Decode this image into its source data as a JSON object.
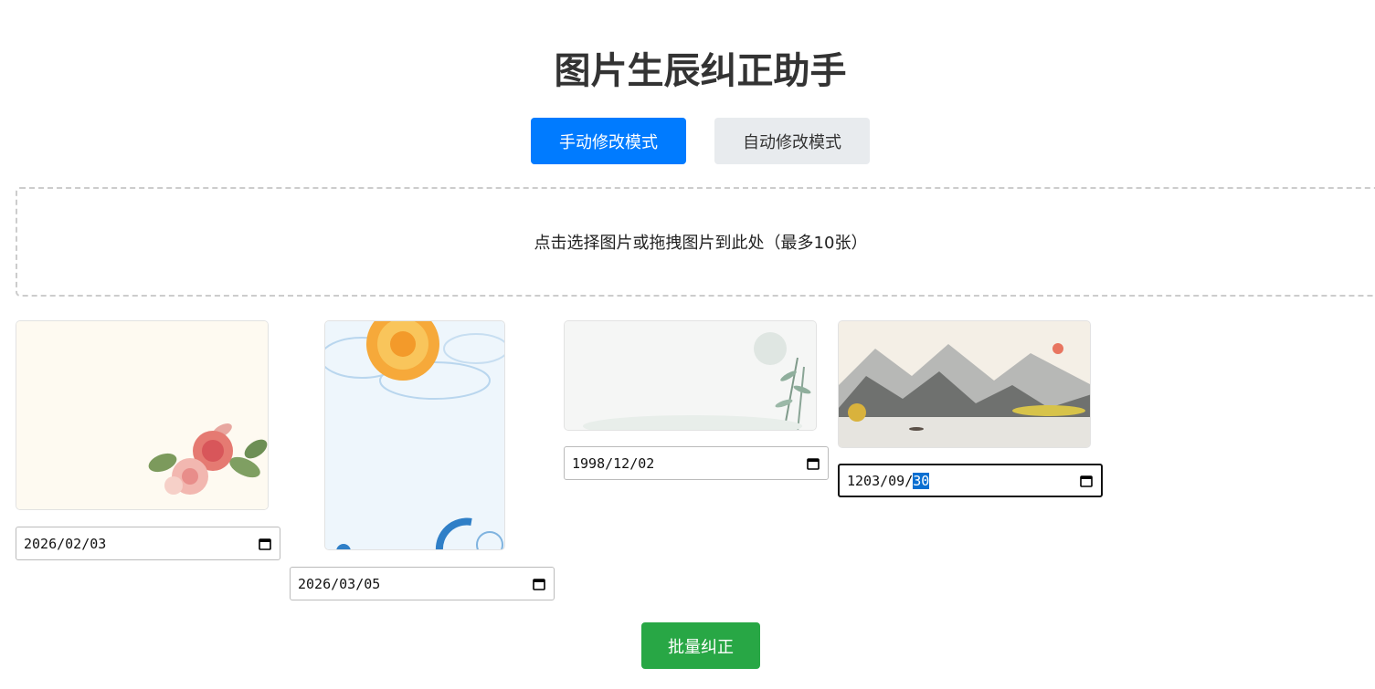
{
  "header": {
    "title": "图片生辰纠正助手"
  },
  "modes": {
    "manual_label": "手动修改模式",
    "auto_label": "自动修改模式"
  },
  "upload": {
    "prompt": "点击选择图片或拖拽图片到此处（最多10张）"
  },
  "images": [
    {
      "date": "2026/02/03"
    },
    {
      "date": "2026/03/05"
    },
    {
      "date": "1998/12/02"
    },
    {
      "date_prefix": "1203/09/",
      "date_selected": "30"
    }
  ],
  "actions": {
    "batch_label": "批量纠正"
  },
  "colors": {
    "primary": "#007bff",
    "success": "#28a745",
    "secondary": "#e8ebee"
  }
}
